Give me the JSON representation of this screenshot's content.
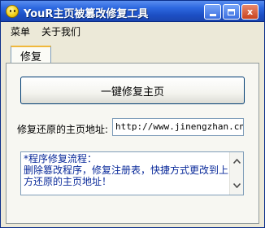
{
  "window": {
    "title": "YouR主页被篡改修复工具"
  },
  "titlebar": {
    "minimize_glyph": "",
    "close_glyph": "x"
  },
  "menu": {
    "items": [
      "菜单",
      "关于我们"
    ]
  },
  "tabs": [
    {
      "label": "修复"
    }
  ],
  "main": {
    "fix_button_label": "一键修复主页",
    "url_label": "修复还原的主页地址:",
    "url_value": "http://www.jinengzhan.cn",
    "info_text": "*程序修复流程：\n删除篡改程序，修复注册表，快捷方式更改到上\n方还原的主页地址！"
  },
  "icons": {
    "app_icon": "smiley-icon",
    "scroll_up": "scroll-up-arrow-icon",
    "scroll_down": "scroll-down-arrow-icon"
  },
  "colors": {
    "titlebar": "#2d68e0",
    "window_bg": "#ece9d8",
    "info_text": "#0a2a9a",
    "tab_accent": "#f0b83c"
  }
}
